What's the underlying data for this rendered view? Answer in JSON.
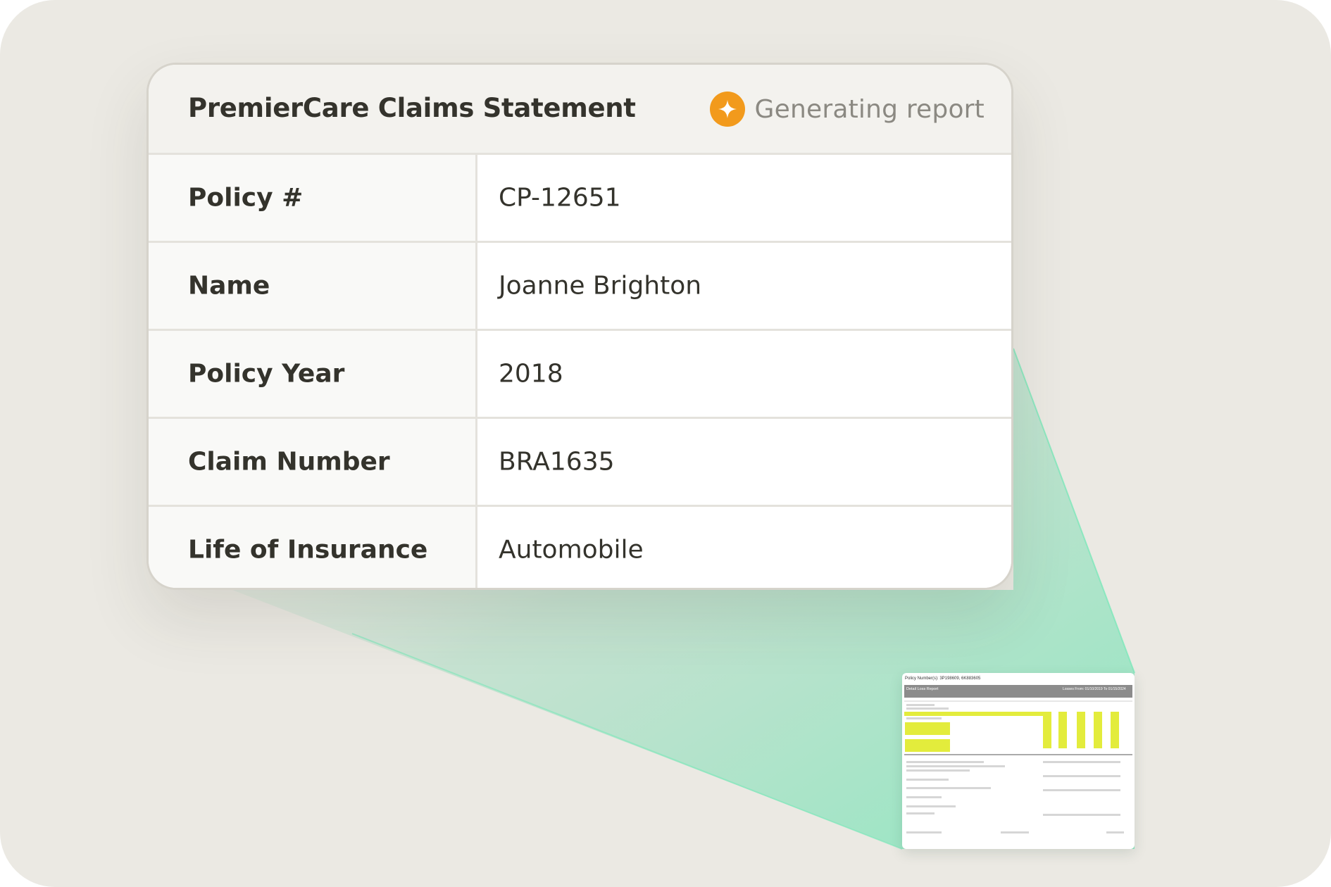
{
  "card": {
    "title": "PremierCare Claims Statement",
    "status": {
      "icon": "sparkle-icon",
      "text": "Generating report"
    },
    "rows": [
      {
        "label": "Policy #",
        "value": "CP-12651"
      },
      {
        "label": "Name",
        "value": "Joanne Brighton"
      },
      {
        "label": "Policy Year",
        "value": "2018"
      },
      {
        "label": "Claim Number",
        "value": "BRA1635"
      },
      {
        "label": "Life of Insurance",
        "value": "Automobile"
      }
    ]
  },
  "document_preview": {
    "header_text": "Policy Number(s): 3P198609, 6K883605",
    "banner_title": "Detail Loss Report",
    "banner_right": "Losses From: 01/10/2019 To 01/15/2024"
  },
  "colors": {
    "background": "#ebe9e3",
    "accent": "#f29a1c",
    "highlight": "#e3ec3c",
    "beam": "#6fe0b0"
  }
}
